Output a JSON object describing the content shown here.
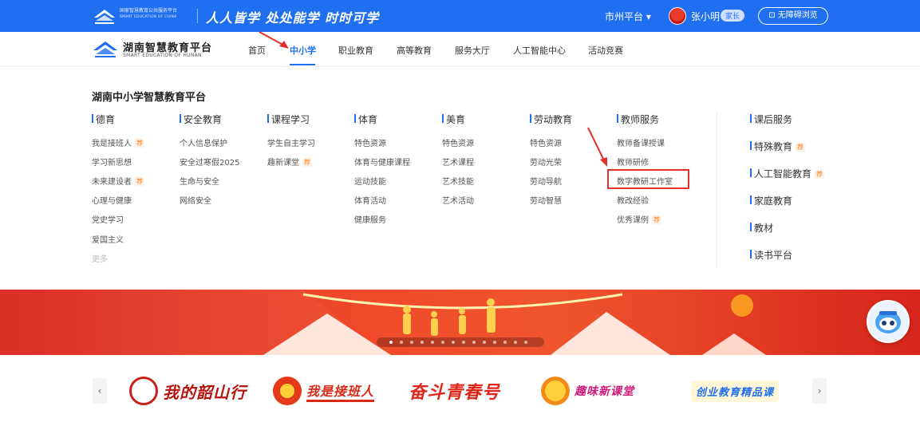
{
  "topbar": {
    "org_cn": "国家智慧教育公共服务平台",
    "org_en": "SMART EDUCATION OF CHINA",
    "slogan": "人人皆学 处处能学 时时可学",
    "region": "市州平台 ▾",
    "username": "张小明",
    "role": "家长",
    "a11y": "⊡ 无障碍浏览"
  },
  "brand": {
    "name_cn": "湖南智慧教育平台",
    "name_en": "SMART EDUCATION OF HUNAN"
  },
  "nav": [
    "首页",
    "中小学",
    "职业教育",
    "高等教育",
    "服务大厅",
    "人工智能中心",
    "活动竞赛"
  ],
  "panel": {
    "title": "湖南中小学智慧教育平台",
    "columns": [
      {
        "head": "德育",
        "links": [
          "我是接班人",
          "学习新思想",
          "未来建设者",
          "心理与健康",
          "党史学习",
          "爱国主义",
          "更多"
        ]
      },
      {
        "head": "安全教育",
        "links": [
          "个人信息保护",
          "安全过寒假2025",
          "生命与安全",
          "网络安全"
        ]
      },
      {
        "head": "课程学习",
        "links": [
          "学生自主学习",
          "趣新课堂"
        ]
      },
      {
        "head": "体育",
        "links": [
          "特色资源",
          "体育与健康课程",
          "运动技能",
          "体育活动",
          "健康服务"
        ]
      },
      {
        "head": "美育",
        "links": [
          "特色资源",
          "艺术课程",
          "艺术技能",
          "艺术活动"
        ]
      },
      {
        "head": "劳动教育",
        "links": [
          "特色资源",
          "劳动光荣",
          "劳动导航",
          "劳动智慧"
        ]
      },
      {
        "head": "教师服务",
        "links": [
          "教师备课授课",
          "教师研修",
          "数字教研工作室",
          "教改经验",
          "优秀课例"
        ]
      }
    ],
    "right": [
      "课后服务",
      "特殊教育",
      "人工智能教育",
      "家庭教育",
      "教材",
      "读书平台"
    ],
    "rec_tag": "荐"
  },
  "carousel": {
    "prev": "‹",
    "next": "›",
    "items": [
      "我的韶山行",
      "我是接班人",
      "奋斗青春号",
      "趣味新课堂",
      "创业教育精品课"
    ]
  },
  "colors": {
    "primary": "#1f6ff0",
    "banner": "#e8392a",
    "highlight": "#e0332a",
    "recommend": "#ff7a1a"
  }
}
